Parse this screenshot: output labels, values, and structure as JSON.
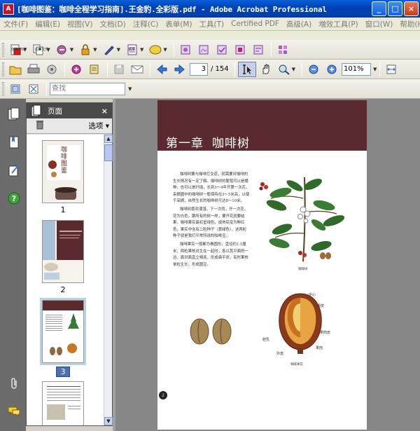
{
  "window": {
    "title": "[咖啡图鉴：咖啡全程学习指南].王金豹.全彩版.pdf - Adobe Acrobat Professional",
    "app_icon": "acrobat-icon",
    "minimize": "_",
    "maximize": "□",
    "close": "×"
  },
  "menu": {
    "items": [
      "文件(F)",
      "编辑(E)",
      "视图(V)",
      "文档(D)",
      "注释(C)",
      "表单(M)",
      "工具(T)",
      "Certified PDF",
      "高级(A)",
      "増效工具(P)",
      "窗口(W)",
      "帮助(H)"
    ],
    "close_doc": "×"
  },
  "toolbar1": {
    "create_pdf": "创建 PDF",
    "combine": "合并文件",
    "forms": "表单"
  },
  "toolbar2": {
    "current_page": "3",
    "page_count": "/ 154",
    "zoom": "101%"
  },
  "toolbar3": {
    "search_placeholder": "查找"
  },
  "panel": {
    "title": "页面",
    "close": "×",
    "options": "选项 ▾",
    "thumbnails": [
      {
        "label": "1",
        "cover_text": "咖啡图鉴"
      },
      {
        "label": "2"
      },
      {
        "label": "3",
        "selected": true
      },
      {
        "label": ""
      }
    ]
  },
  "page": {
    "chapter": "第一章",
    "chapter_title": "咖啡树",
    "paragraphs": [
      "咖啡树要与咖啡打交道，就需要对咖啡的生长情况有一定了解。咖啡树的繁殖可以是播种，也可以是扦插，长到3～4年开第一次花，采摘圆中的咖啡树一般保持在3～5米高，以便于采摘，自然生长的咖啡树可达8～10米。",
      "咖啡树喜欢潮湿，下一次雨，开一次花，花为白色，跟所有的树一样，要开花就要结果，咖啡果实最初呈绿色，成熟后变为鲜红色，果实中含有二粒种子（黄绿色），这两粒种子就是我们平常所说的咖啡豆。",
      "咖啡果实一般都为椭圆形，直径约1.5厘米，两粒果核对生在一起时，各以其平面的一边，面对面直立相连，形成扁平状，有时果核单粒生长，形成圆豆。"
    ],
    "plant_caption": "咖啡树",
    "diagram_caption": "咖啡果实",
    "labels": {
      "center": "中心",
      "silverskin": "银皮",
      "parchment": "果肉皮",
      "pulp": "果肉",
      "husk": "外皮",
      "endosperm": "胚乳"
    },
    "page_number": "2"
  }
}
